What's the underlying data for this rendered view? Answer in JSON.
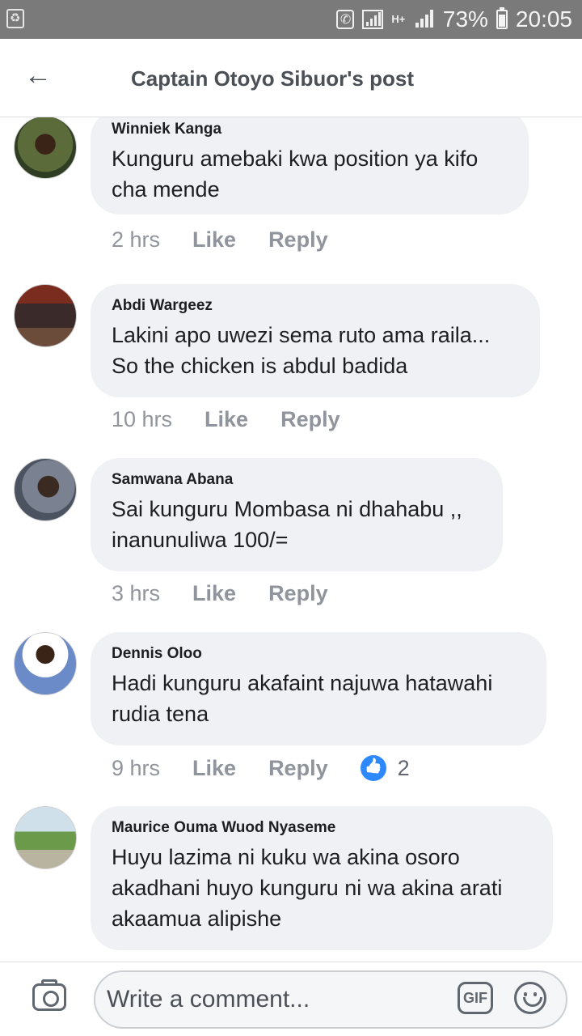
{
  "status_bar": {
    "battery": "73%",
    "time": "20:05",
    "network": "H+"
  },
  "header": {
    "title": "Captain Otoyo Sibuor's post"
  },
  "comments": [
    {
      "author": "Winniek Kanga",
      "text": "Kunguru amebaki kwa position ya kifo cha mende",
      "time": "2 hrs",
      "like": "Like",
      "reply": "Reply",
      "reactions": ""
    },
    {
      "author": "Abdi Wargeez",
      "text": "Lakini apo uwezi sema ruto ama raila... So the chicken is abdul badida",
      "time": "10 hrs",
      "like": "Like",
      "reply": "Reply",
      "reactions": ""
    },
    {
      "author": "Samwana Abana",
      "text": "Sai kunguru Mombasa ni dhahabu ,, inanunuliwa 100/=",
      "time": "3 hrs",
      "like": "Like",
      "reply": "Reply",
      "reactions": ""
    },
    {
      "author": "Dennis Oloo",
      "text": "Hadi kunguru akafaint najuwa hatawahi rudia tena",
      "time": "9 hrs",
      "like": "Like",
      "reply": "Reply",
      "reactions": "2"
    },
    {
      "author": "Maurice Ouma Wuod Nyaseme",
      "text": "Huyu lazima ni kuku wa akina osoro akadhani huyo kunguru ni wa akina arati akaamua alipishe",
      "time": "",
      "like": "",
      "reply": "",
      "reactions": ""
    }
  ],
  "composer": {
    "placeholder": "Write a comment...",
    "gif_label": "GIF"
  },
  "colors": {
    "status_bar_bg": "#7a7a7a",
    "bubble_bg": "#f0f1f4",
    "like_blue": "#2e89ff",
    "meta_gray": "#90949c"
  }
}
